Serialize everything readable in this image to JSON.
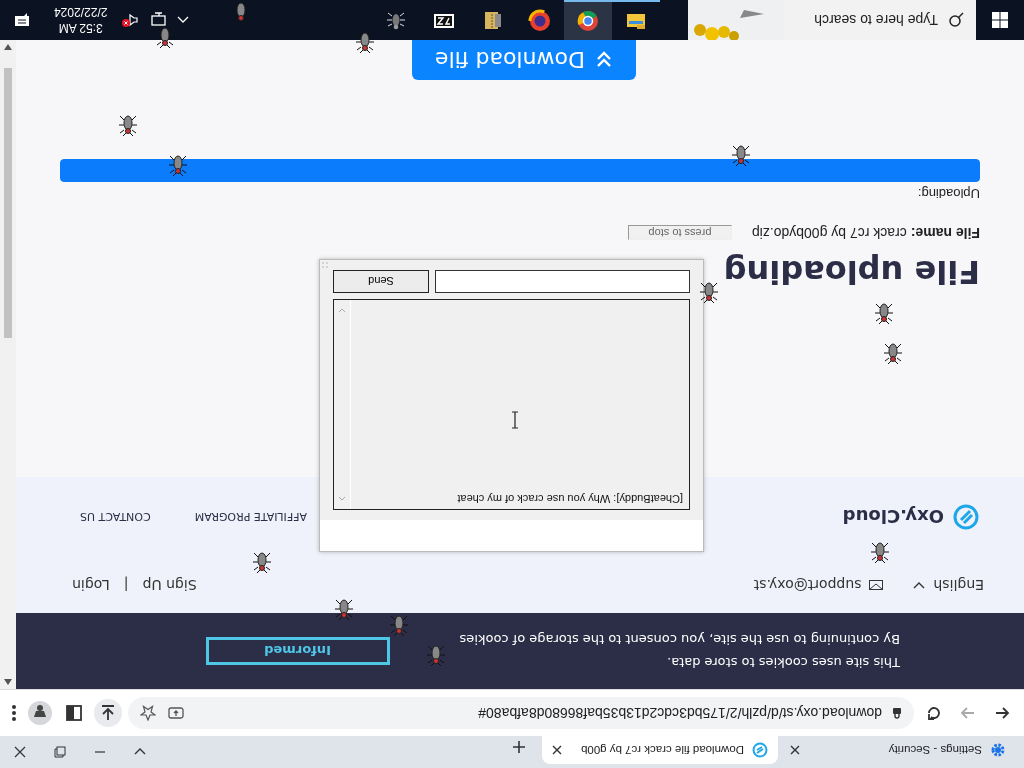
{
  "browser": {
    "tabs": [
      {
        "title": "Settings - Security",
        "kind": "settings",
        "selected": false
      },
      {
        "title": "Download file crack rc7 by g00b",
        "kind": "site",
        "selected": true
      }
    ],
    "url": "download.oxy.st/d/pzlh/2/175bd3cdc2d13b35baf86680d8afba80#"
  },
  "cookie_banner": {
    "lines": [
      "This site uses cookies to store data.",
      "By continuing to use the site, you consent to the storage of cookies"
    ],
    "button": "Informed"
  },
  "header": {
    "language": "English",
    "email": "support@oxy.st",
    "sign_up": "Sign Up",
    "separator": "|",
    "login": "Login"
  },
  "nav": {
    "logo": "Oxy.Cloud",
    "links": [
      "AFFILIATE PROGRAM",
      "CONTACT US"
    ]
  },
  "upload": {
    "title": "File uploading",
    "file_label": "File name:",
    "file_name": "crack rc7 by g00bydo.zip",
    "stop_button": "press to stop",
    "progress_label": "Uploading:",
    "level": 1,
    "download_button": "Download file"
  },
  "chat": {
    "messages": [
      "[CheatBuddy]: Why you use crack of my cheat"
    ],
    "send": "Send"
  },
  "taskbar": {
    "search_placeholder": "Type here to search",
    "apps": [
      {
        "kind": "folder",
        "running": true,
        "selected": false
      },
      {
        "kind": "chrome",
        "running": true,
        "selected": true
      },
      {
        "kind": "redapp",
        "running": false,
        "selected": false
      },
      {
        "kind": "archive",
        "running": false,
        "selected": false
      },
      {
        "kind": "sevenzip",
        "running": false,
        "selected": false
      },
      {
        "kind": "bug",
        "running": false,
        "selected": false
      }
    ],
    "time": "3:52 AM",
    "date": "2/22/2024"
  }
}
